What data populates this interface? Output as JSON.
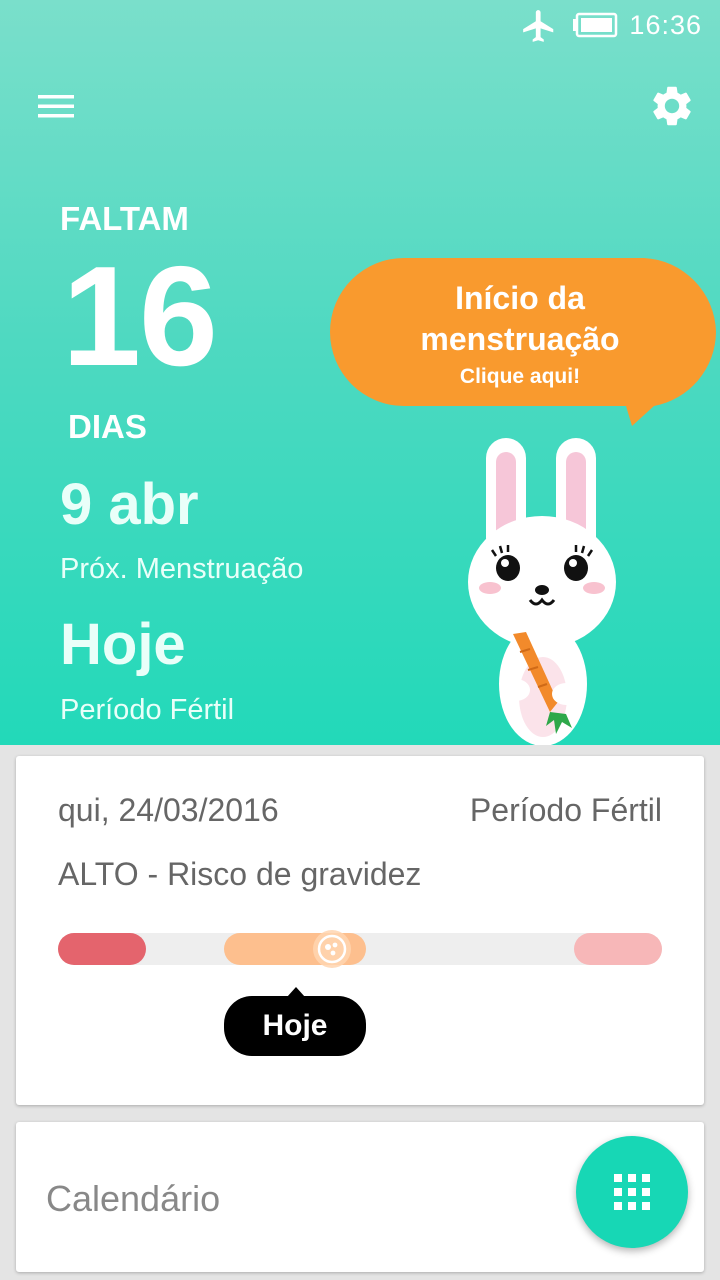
{
  "status_bar": {
    "time": "16:36"
  },
  "countdown": {
    "prefix": "FALTAM",
    "days": "16",
    "suffix": "DIAS"
  },
  "next_period": {
    "date": "9 abr",
    "label": "Próx. Menstruação"
  },
  "fertile": {
    "value": "Hoje",
    "label": "Período Fértil"
  },
  "bubble": {
    "line1": "Início da",
    "line2": "menstruação",
    "line3": "Clique aqui!"
  },
  "day_card": {
    "date": "qui, 24/03/2016",
    "phase": "Período Fértil",
    "risk": "ALTO - Risco de gravidez",
    "tooltip": "Hoje"
  },
  "calendar_card": {
    "label": "Calendário"
  },
  "colors": {
    "accent": "#17d7b5",
    "bubble": "#f99a2e",
    "menses": "#e4646d",
    "fertile": "#fdbf8e",
    "next_menses": "#f7b7b8"
  }
}
